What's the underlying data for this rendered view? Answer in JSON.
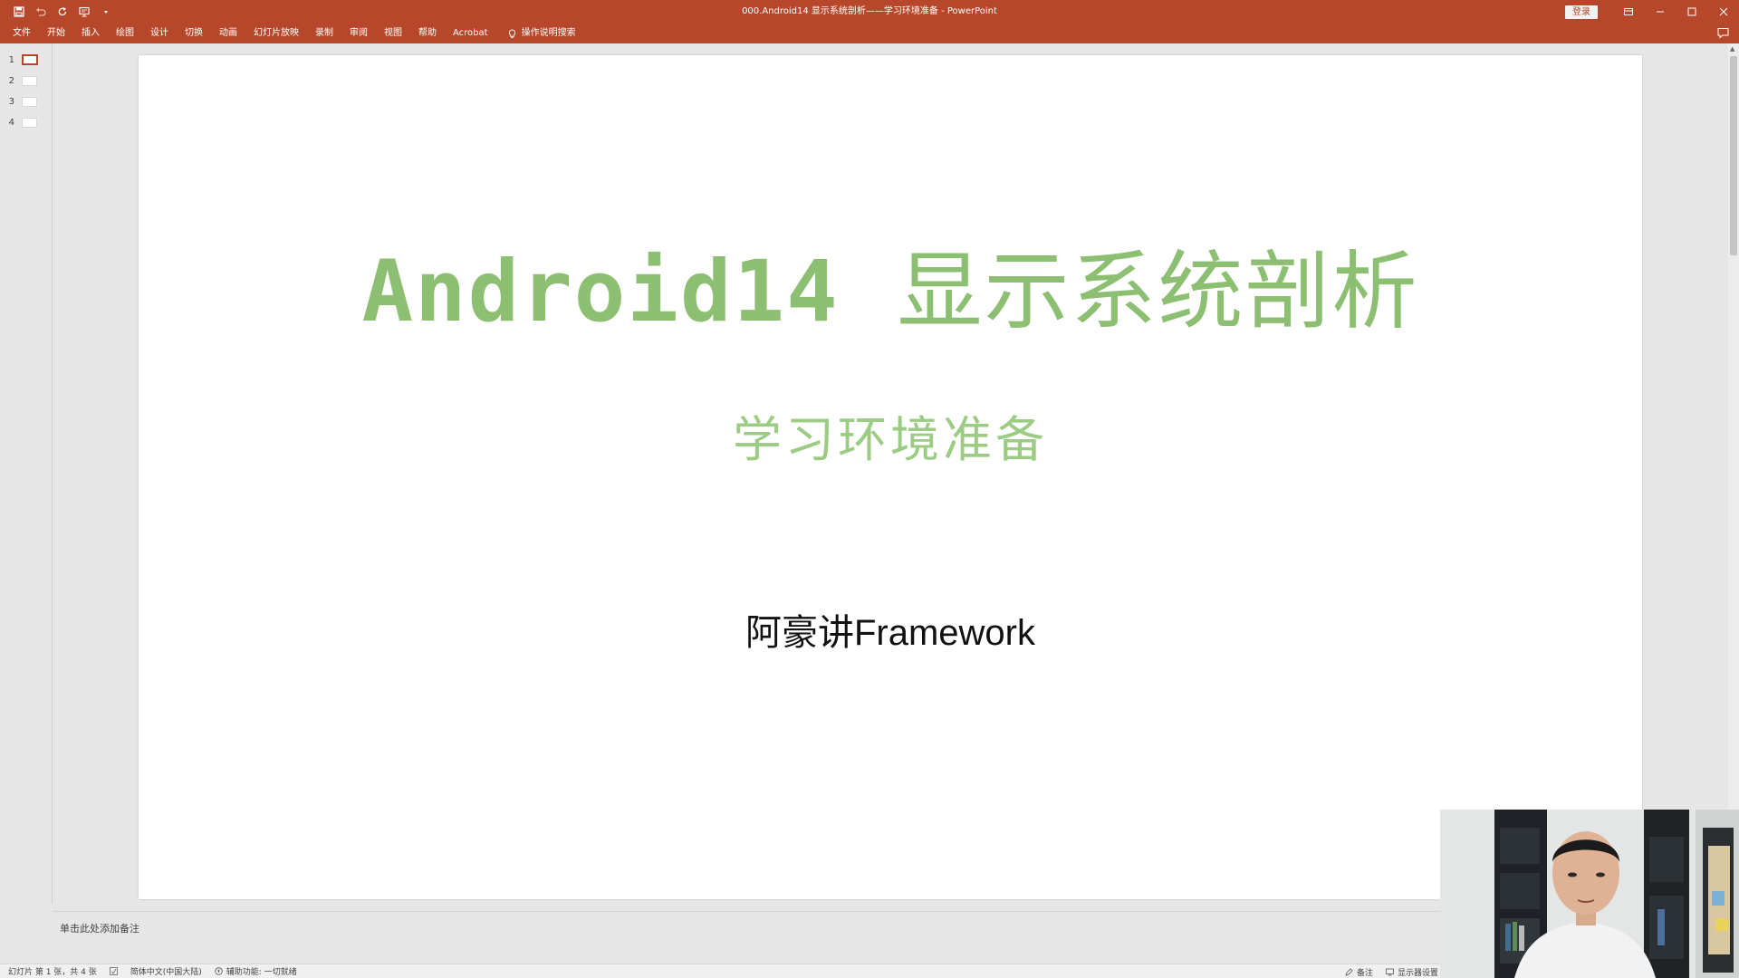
{
  "titlebar": {
    "document_title": "000.Android14 显示系统剖析——学习环境准备 - PowerPoint",
    "login_label": "登录",
    "qat": [
      {
        "name": "save-icon"
      },
      {
        "name": "undo-icon"
      },
      {
        "name": "redo-icon"
      },
      {
        "name": "present-icon"
      },
      {
        "name": "customize-qat-icon"
      }
    ]
  },
  "ribbon": {
    "tabs": [
      "文件",
      "开始",
      "插入",
      "绘图",
      "设计",
      "切换",
      "动画",
      "幻灯片放映",
      "录制",
      "审阅",
      "视图",
      "帮助",
      "Acrobat"
    ],
    "tell_me": "操作说明搜索"
  },
  "thumbnails": [
    {
      "number": "1",
      "active": true
    },
    {
      "number": "2",
      "active": false
    },
    {
      "number": "3",
      "active": false
    },
    {
      "number": "4",
      "active": false
    }
  ],
  "slide": {
    "title_en": "Android14",
    "title_zh": "显示系统剖析",
    "subtitle": "学习环境准备",
    "author": "阿豪讲Framework"
  },
  "notes": {
    "placeholder": "单击此处添加备注"
  },
  "statusbar": {
    "slide_info": "幻灯片 第 1 张，共 4 张",
    "language": "简体中文(中国大陆)",
    "accessibility": "辅助功能: 一切就绪",
    "notes_label": "备注",
    "display_settings": "显示器设置"
  },
  "colors": {
    "accent": "#b7472a",
    "title_green": "#8dbf72",
    "subtitle_green": "#9ccb83"
  }
}
